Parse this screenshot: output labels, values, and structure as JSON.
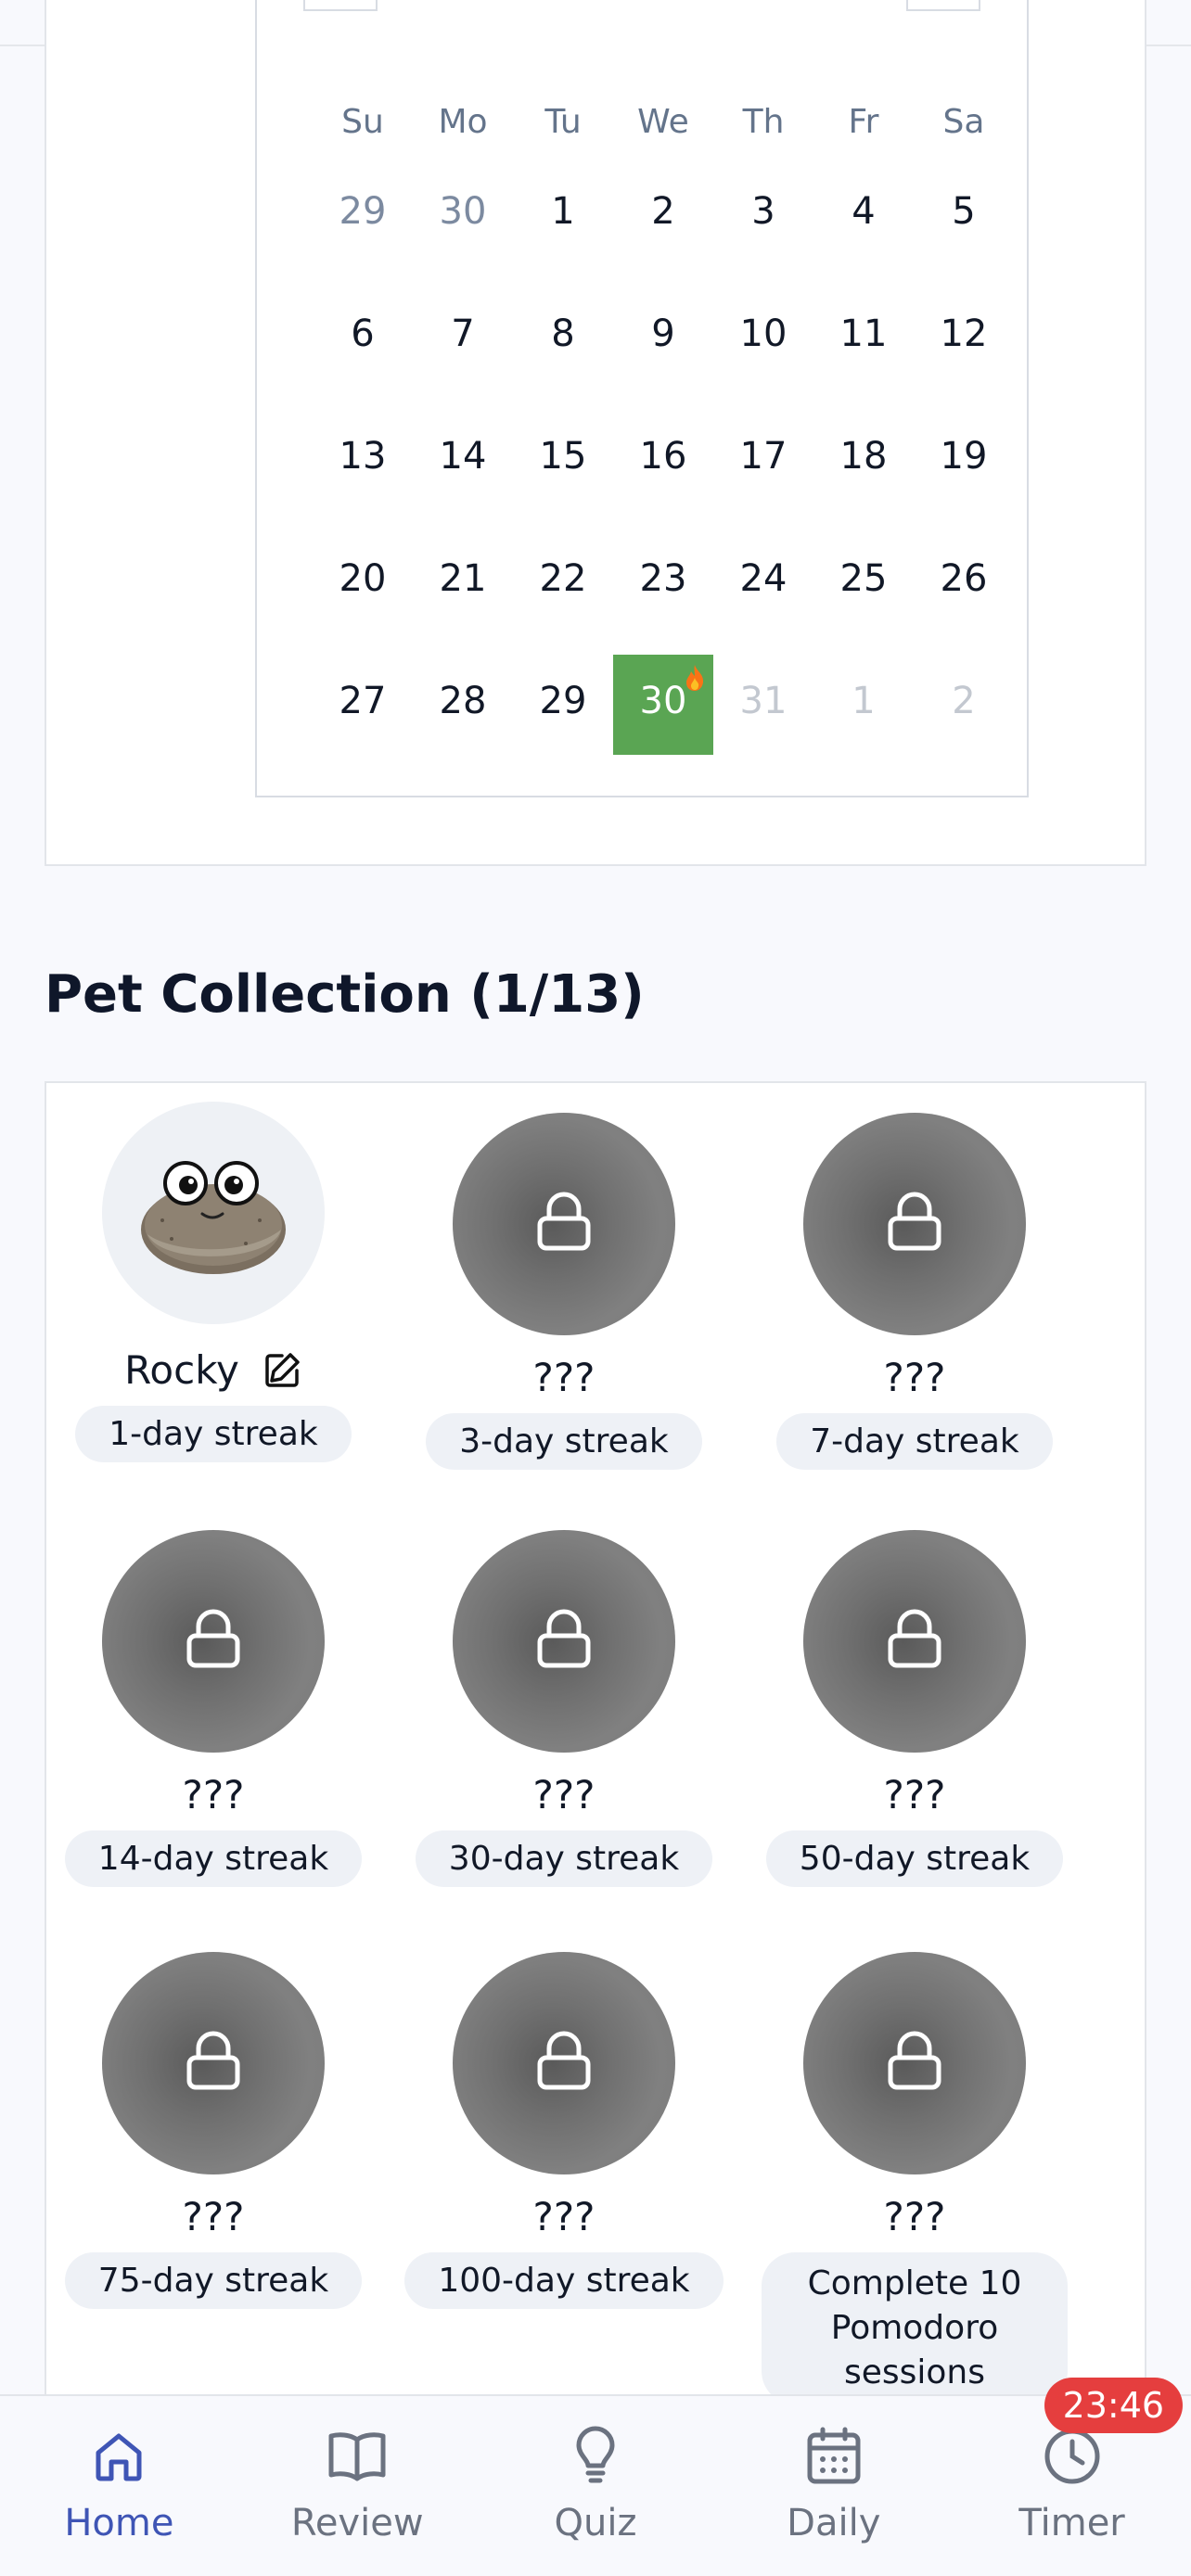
{
  "calendar": {
    "weekdays": [
      "Su",
      "Mo",
      "Tu",
      "We",
      "Th",
      "Fr",
      "Sa"
    ],
    "weeks": [
      [
        {
          "d": "29",
          "s": "muted"
        },
        {
          "d": "30",
          "s": "muted"
        },
        {
          "d": "1",
          "s": ""
        },
        {
          "d": "2",
          "s": ""
        },
        {
          "d": "3",
          "s": ""
        },
        {
          "d": "4",
          "s": ""
        },
        {
          "d": "5",
          "s": ""
        }
      ],
      [
        {
          "d": "6",
          "s": ""
        },
        {
          "d": "7",
          "s": ""
        },
        {
          "d": "8",
          "s": ""
        },
        {
          "d": "9",
          "s": ""
        },
        {
          "d": "10",
          "s": ""
        },
        {
          "d": "11",
          "s": ""
        },
        {
          "d": "12",
          "s": ""
        }
      ],
      [
        {
          "d": "13",
          "s": ""
        },
        {
          "d": "14",
          "s": ""
        },
        {
          "d": "15",
          "s": ""
        },
        {
          "d": "16",
          "s": ""
        },
        {
          "d": "17",
          "s": ""
        },
        {
          "d": "18",
          "s": ""
        },
        {
          "d": "19",
          "s": ""
        }
      ],
      [
        {
          "d": "20",
          "s": ""
        },
        {
          "d": "21",
          "s": ""
        },
        {
          "d": "22",
          "s": ""
        },
        {
          "d": "23",
          "s": ""
        },
        {
          "d": "24",
          "s": ""
        },
        {
          "d": "25",
          "s": ""
        },
        {
          "d": "26",
          "s": ""
        }
      ],
      [
        {
          "d": "27",
          "s": ""
        },
        {
          "d": "28",
          "s": ""
        },
        {
          "d": "29",
          "s": ""
        },
        {
          "d": "30",
          "s": "today"
        },
        {
          "d": "31",
          "s": "faded"
        },
        {
          "d": "1",
          "s": "faded"
        },
        {
          "d": "2",
          "s": "faded"
        }
      ]
    ],
    "today_color": "#5aa553",
    "streak_icon": "flame-icon"
  },
  "pets": {
    "title": "Pet Collection (1/13)",
    "items": [
      {
        "name": "Rocky",
        "requirement": "1-day streak",
        "unlocked": true
      },
      {
        "name": "???",
        "requirement": "3-day streak",
        "unlocked": false
      },
      {
        "name": "???",
        "requirement": "7-day streak",
        "unlocked": false
      },
      {
        "name": "???",
        "requirement": "14-day streak",
        "unlocked": false
      },
      {
        "name": "???",
        "requirement": "30-day streak",
        "unlocked": false
      },
      {
        "name": "???",
        "requirement": "50-day streak",
        "unlocked": false
      },
      {
        "name": "???",
        "requirement": "75-day streak",
        "unlocked": false
      },
      {
        "name": "???",
        "requirement": "100-day streak",
        "unlocked": false
      },
      {
        "name": "???",
        "requirement": "Complete 10 Pomodoro sessions",
        "unlocked": false
      }
    ]
  },
  "nav": {
    "items": [
      {
        "label": "Home",
        "icon": "home-icon",
        "active": true
      },
      {
        "label": "Review",
        "icon": "book-icon",
        "active": false
      },
      {
        "label": "Quiz",
        "icon": "lightbulb-icon",
        "active": false
      },
      {
        "label": "Daily",
        "icon": "calendar-icon",
        "active": false
      },
      {
        "label": "Timer",
        "icon": "clock-icon",
        "active": false
      }
    ],
    "timer_badge": "23:46",
    "active_color": "#3f55b5"
  }
}
